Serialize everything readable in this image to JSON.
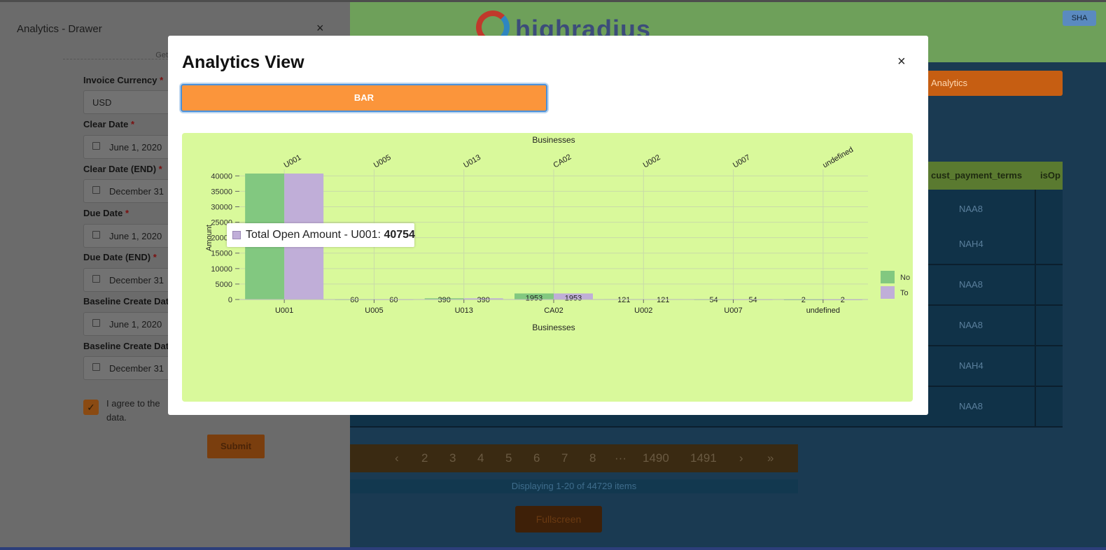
{
  "app": {
    "logo_text": "highradius",
    "user_badge": "SHA",
    "analytics_button": "Analytics",
    "grid_headers": [
      "cust_payment_terms",
      "isOp"
    ],
    "rows": [
      "NAA8",
      "NAH4",
      "NAA8",
      "NAA8",
      "NAH4",
      "NAA8"
    ],
    "pagination": [
      "‹",
      "2",
      "3",
      "4",
      "5",
      "6",
      "7",
      "8",
      "···",
      "1490",
      "1491",
      "›",
      "»"
    ],
    "displaying": "Displaying 1-20 of 44729 items",
    "fullscreen_button": "Fullscreen"
  },
  "drawer": {
    "title": "Analytics - Drawer",
    "close": "×",
    "subtitle": "Get",
    "fields": [
      {
        "label": "Invoice Currency",
        "value": "USD",
        "type": "select"
      },
      {
        "label": "Clear Date",
        "value": "June 1, 2020",
        "type": "date"
      },
      {
        "label": "Clear Date (END)",
        "value": "December 31",
        "type": "date"
      },
      {
        "label": "Due Date",
        "value": "June 1, 2020",
        "type": "date"
      },
      {
        "label": "Due Date (END)",
        "value": "December 31",
        "type": "date"
      },
      {
        "label": "Baseline Create Dat",
        "value": "June 1, 2020",
        "type": "date"
      },
      {
        "label": "Baseline Create Dat",
        "value": "December 31",
        "type": "date"
      }
    ],
    "required_mark": "*",
    "agree_text": "I agree to the data.",
    "agree_checked": "✓",
    "submit": "Submit"
  },
  "modal": {
    "title": "Analytics View",
    "close": "×",
    "bar_button": "BAR",
    "tooltip": {
      "label": "Total Open Amount - U001: ",
      "value": "40754"
    }
  },
  "chart_data": {
    "type": "bar",
    "title": "Businesses",
    "xlabel": "Businesses",
    "ylabel": "Amount",
    "categories": [
      "U001",
      "U005",
      "U013",
      "CA02",
      "U002",
      "U007",
      "undefined"
    ],
    "series": [
      {
        "name": "No",
        "color": "#82c880",
        "values": [
          40754,
          60,
          390,
          1953,
          121,
          54,
          2
        ]
      },
      {
        "name": "To",
        "color": "#c0aed8",
        "values": [
          40754,
          60,
          390,
          1953,
          121,
          54,
          2
        ]
      }
    ],
    "yticks": [
      0,
      5000,
      10000,
      15000,
      20000,
      25000,
      30000,
      35000,
      40000
    ],
    "ylim": [
      0,
      40754
    ],
    "grid": true,
    "legend": "right"
  }
}
